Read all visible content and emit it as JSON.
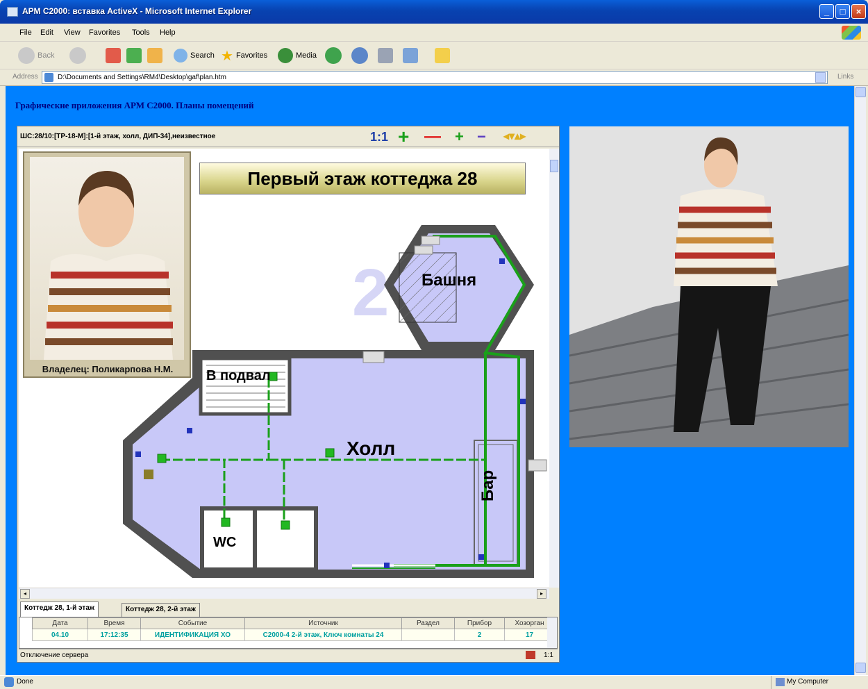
{
  "window": {
    "title": "АРМ С2000: вставка ActiveX - Microsoft Internet Explorer",
    "minimize": "_",
    "maximize": "□",
    "close": "×"
  },
  "menu": [
    "File",
    "Edit",
    "View",
    "Favorites",
    "Tools",
    "Help"
  ],
  "toolbar": {
    "back": "Back",
    "search": "Search",
    "favorites": "Favorites",
    "media": "Media"
  },
  "address": {
    "label": "Address",
    "value": "D:\\Documents and Settings\\RM4\\Desktop\\gaf\\plan.htm",
    "links": "Links"
  },
  "page": {
    "heading": "Графические приложения АРМ С2000. Планы помещений"
  },
  "plan": {
    "state_text": "ШС:28/10:[ТР-18-М]:[1-й этаж, холл, ДИП-34],неизвестное",
    "tools": {
      "one_to_one": "1:1",
      "plus": "+",
      "minus": "—",
      "zoom_in": "+",
      "zoom_out": "−",
      "nav": "◂▾▴▸"
    },
    "title": "Первый этаж коттеджа 28",
    "owner": "Владелец: Поликарпова Н.М.",
    "rooms": {
      "tower": "Башня",
      "basement": "В подвал",
      "hall": "Холл",
      "bar": "Бар",
      "wc": "WC"
    },
    "floor_number": "2"
  },
  "tabs": [
    {
      "label": "Коттедж 28, 1-й этаж",
      "active": true
    },
    {
      "label": "Коттедж 28, 2-й этаж",
      "active": false
    }
  ],
  "events": {
    "columns": [
      "Дата",
      "Время",
      "Событие",
      "Источник",
      "Раздел",
      "Прибор",
      "Хозорган"
    ],
    "rows": [
      [
        "04.10",
        "17:12:35",
        "ИДЕНТИФИКАЦИЯ ХО",
        "С2000-4 2-й этаж, Ключ комнаты 24",
        "",
        "2",
        "17"
      ]
    ]
  },
  "event_status": "Отключение сервера",
  "event_counter": "1:1",
  "statusbar": {
    "left": "Done",
    "zone": "My Computer"
  },
  "colors": {
    "content_bg": "#0080ff",
    "room_fill": "#c8c8f8",
    "wall": "#505050",
    "line_green": "#1aa01a"
  }
}
